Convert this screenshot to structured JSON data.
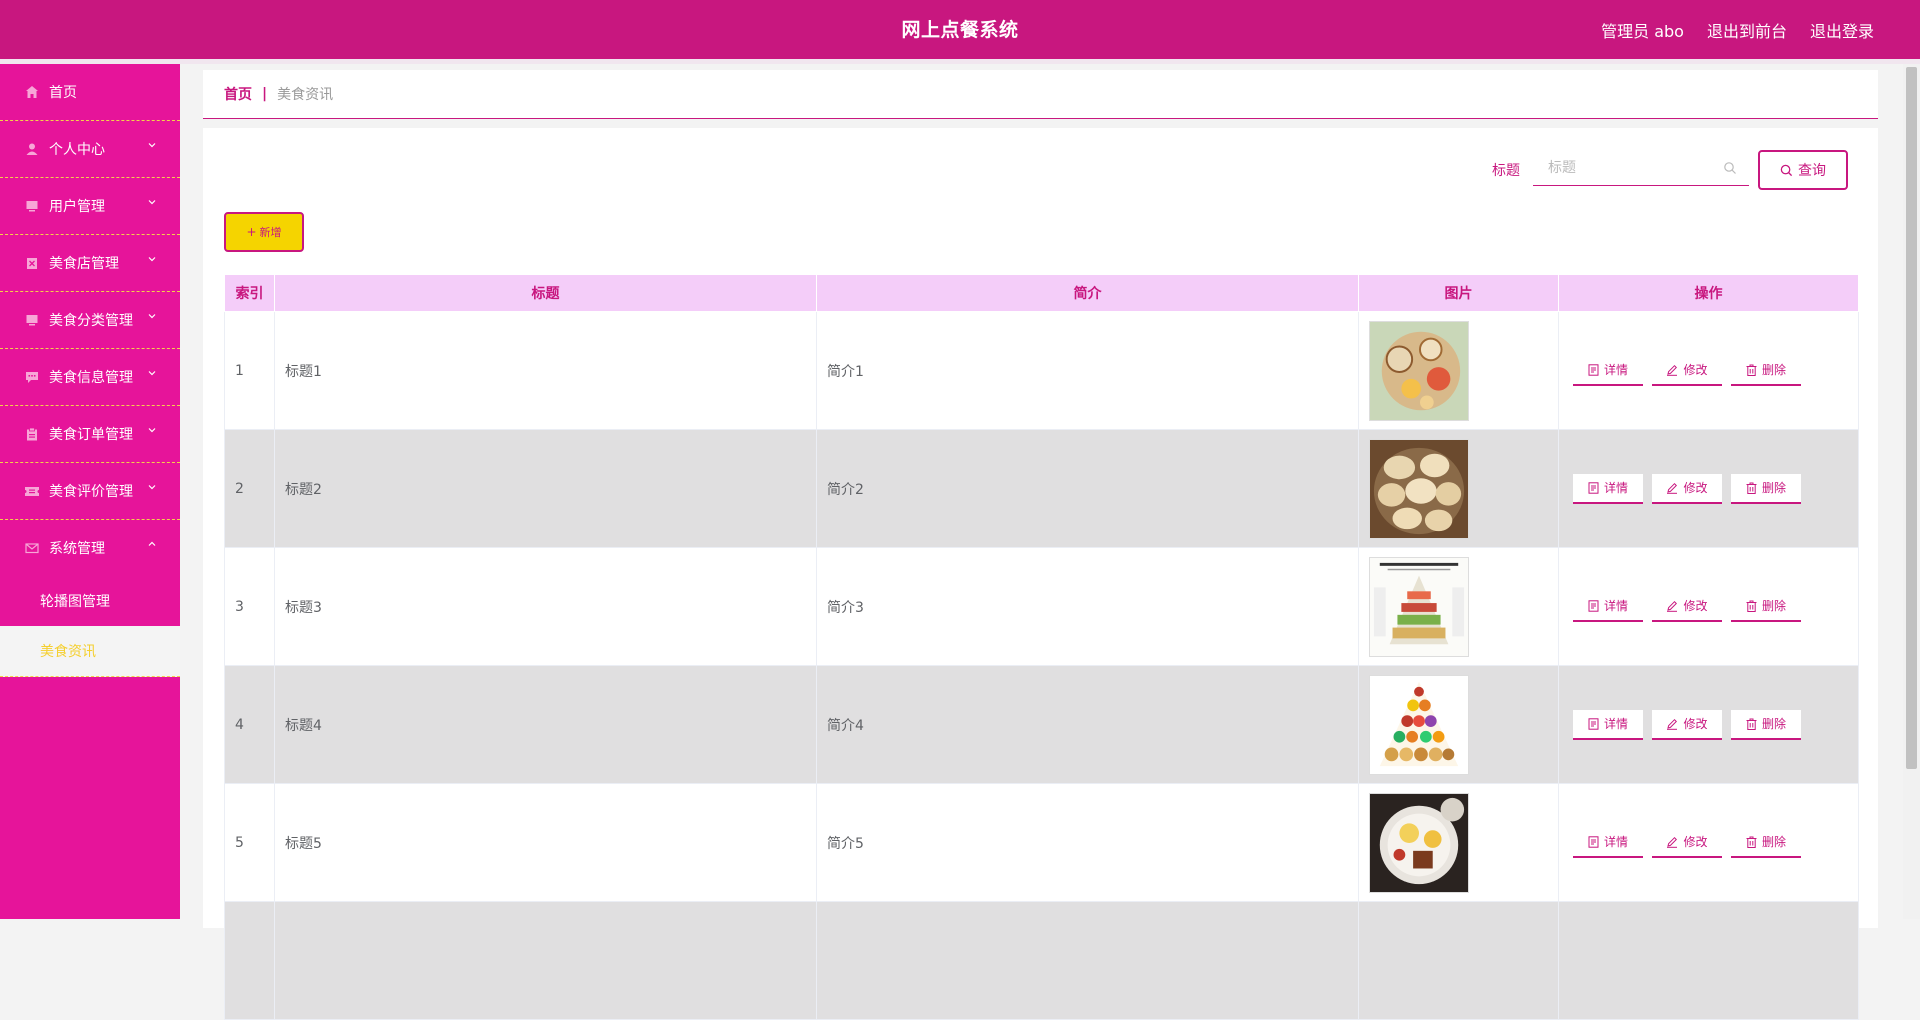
{
  "header": {
    "title": "网上点餐系统",
    "user_label": "管理员 abo",
    "to_frontend": "退出到前台",
    "logout": "退出登录"
  },
  "sidebar": {
    "items": [
      {
        "label": "首页",
        "icon": "home-icon"
      },
      {
        "label": "个人中心",
        "icon": "user-icon"
      },
      {
        "label": "用户管理",
        "icon": "monitor-icon"
      },
      {
        "label": "美食店管理",
        "icon": "store-icon"
      },
      {
        "label": "美食分类管理",
        "icon": "monitor-icon"
      },
      {
        "label": "美食信息管理",
        "icon": "chat-icon"
      },
      {
        "label": "美食订单管理",
        "icon": "clipboard-icon"
      },
      {
        "label": "美食评价管理",
        "icon": "ticket-icon"
      },
      {
        "label": "系统管理",
        "icon": "mail-icon"
      }
    ],
    "sub_items": [
      {
        "label": "轮播图管理"
      },
      {
        "label": "美食资讯"
      }
    ]
  },
  "breadcrumb": {
    "home": "首页",
    "separator": "|",
    "current": "美食资讯"
  },
  "search": {
    "label": "标题",
    "placeholder": "标题",
    "button": "查询"
  },
  "add_button": "新增",
  "table": {
    "columns": [
      "索引",
      "标题",
      "简介",
      "图片",
      "操作"
    ],
    "rows": [
      {
        "index": "1",
        "title": "标题1",
        "intro": "简介1",
        "image": "food-bowls-photo"
      },
      {
        "index": "2",
        "title": "标题2",
        "intro": "简介2",
        "image": "dumplings-photo"
      },
      {
        "index": "3",
        "title": "标题3",
        "intro": "简介3",
        "image": "healthy-eating-pyramid-poster"
      },
      {
        "index": "4",
        "title": "标题4",
        "intro": "简介4",
        "image": "food-pyramid-illustration"
      },
      {
        "index": "5",
        "title": "标题5",
        "intro": "简介5",
        "image": "breakfast-plate-photo"
      }
    ],
    "actions": {
      "detail": "详情",
      "edit": "修改",
      "delete": "删除"
    }
  },
  "colors": {
    "primary": "#c8177f",
    "sidebar": "#e6149a",
    "accent_yellow": "#f5d400",
    "table_header_bg": "#f4cdf9",
    "stripe_bg": "#e0dfe0"
  }
}
